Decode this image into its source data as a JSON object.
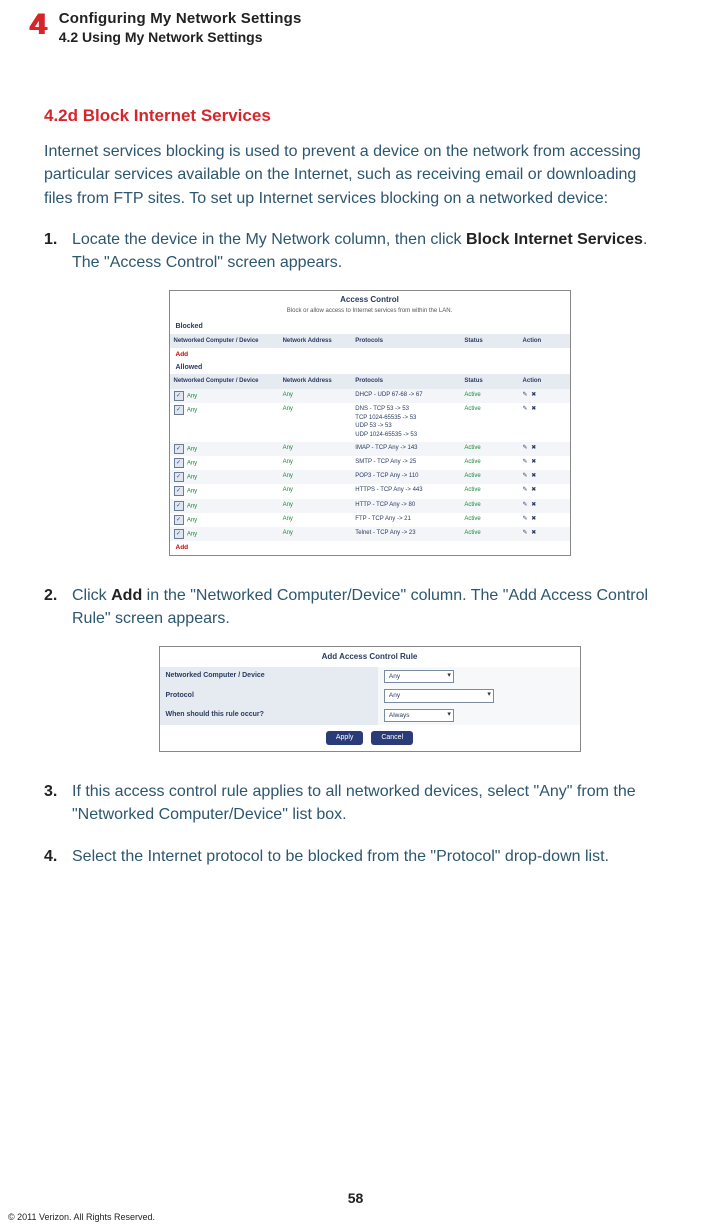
{
  "header": {
    "chapter_number": "4",
    "title1": "Configuring My Network Settings",
    "title2": "4.2  Using My Network Settings"
  },
  "section": {
    "heading": "4.2d  Block Internet Services",
    "intro": "Internet services blocking is used to prevent a device on the network from accessing particular services available on the Internet, such as receiving email or downloading files from FTP sites. To set up Internet services blocking on a networked device:"
  },
  "steps": {
    "s1_a": "Locate the device in the My Network column, then click ",
    "s1_b": "Block Internet Services",
    "s1_c": ". The \"Access Control\" screen appears.",
    "s2_a": "Click ",
    "s2_b": "Add",
    "s2_c": " in the \"Networked Computer/Device\" column. The \"Add Access Control Rule\" screen appears.",
    "s3": "If this access control rule applies to all networked devices, select \"Any\" from the \"Networked Computer/Device\" list box.",
    "s4": "Select the Internet protocol to be blocked from the \"Protocol\" drop-down list."
  },
  "access_control": {
    "title": "Access Control",
    "subtitle": "Block or allow access to Internet services from within the LAN.",
    "blocked_label": "Blocked",
    "allowed_label": "Allowed",
    "add_label": "Add",
    "columns": {
      "device": "Networked Computer / Device",
      "address": "Network Address",
      "protocols": "Protocols",
      "status": "Status",
      "action": "Action"
    },
    "any": "Any",
    "active": "Active",
    "action_icons": "✎ ✖",
    "rows": [
      {
        "proto": "DHCP - UDP 67-68 -> 67"
      },
      {
        "proto": "DNS - TCP 53 -> 53\n     TCP 1024-65535 -> 53\n     UDP 53 -> 53\n     UDP 1024-65535 -> 53"
      },
      {
        "proto": "IMAP - TCP Any -> 143"
      },
      {
        "proto": "SMTP - TCP Any -> 25"
      },
      {
        "proto": "POP3 - TCP Any -> 110"
      },
      {
        "proto": "HTTPS - TCP Any -> 443"
      },
      {
        "proto": "HTTP - TCP Any -> 80"
      },
      {
        "proto": "FTP - TCP Any -> 21"
      },
      {
        "proto": "Telnet - TCP Any -> 23"
      }
    ]
  },
  "add_rule": {
    "title": "Add Access Control Rule",
    "rows": {
      "device_label": "Networked Computer / Device",
      "device_value": "Any",
      "protocol_label": "Protocol",
      "protocol_value": "Any",
      "when_label": "When should this rule occur?",
      "when_value": "Always"
    },
    "apply": "Apply",
    "cancel": "Cancel"
  },
  "footer": {
    "page": "58",
    "copyright": "© 2011 Verizon. All Rights Reserved."
  }
}
